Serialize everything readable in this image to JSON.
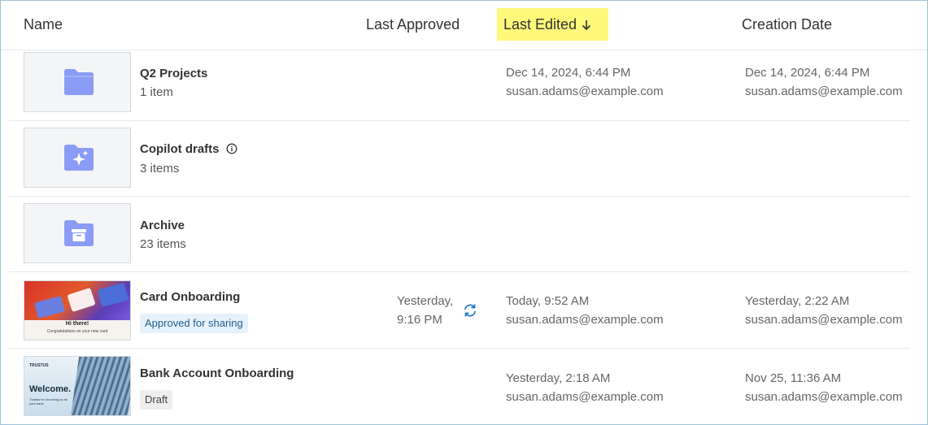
{
  "columns": {
    "name": "Name",
    "last_approved": "Last Approved",
    "last_edited": "Last Edited",
    "creation_date": "Creation Date"
  },
  "sort": {
    "column": "Last Edited",
    "direction": "descending",
    "highlight": "#fff87a"
  },
  "rows": [
    {
      "title": "Q2 Projects",
      "subtitle": "1 item",
      "icon": "folder-icon",
      "edited_date": "Dec 14, 2024, 6:44 PM",
      "edited_by": "susan.adams@example.com",
      "created_date": "Dec 14, 2024, 6:44 PM",
      "created_by": "susan.adams@example.com"
    },
    {
      "title": "Copilot drafts",
      "subtitle": "3 items",
      "icon": "sparkle-folder-icon"
    },
    {
      "title": "Archive",
      "subtitle": "23 items",
      "icon": "archive-folder-icon"
    },
    {
      "title": "Card Onboarding",
      "badge": "Approved for sharing",
      "thumb_heading": "Hi there!",
      "thumb_sub": "Congratulations on your new card",
      "approved_line1": "Yesterday,",
      "approved_line2": "9:16 PM",
      "edited_date": "Today, 9:52 AM",
      "edited_by": "susan.adams@example.com",
      "created_date": "Yesterday, 2:22 AM",
      "created_by": "susan.adams@example.com"
    },
    {
      "title": "Bank Account Onboarding",
      "badge": "Draft",
      "thumb_brand": "TRUSTUS",
      "thumb_heading": "Welcome.",
      "thumb_sub": "Thanks for choosing us as your bank",
      "edited_date": "Yesterday, 2:18 AM",
      "edited_by": "susan.adams@example.com",
      "created_date": "Nov 25, 11:36 AM",
      "created_by": "susan.adams@example.com"
    }
  ],
  "colors": {
    "folder": "#8a9cf5",
    "accent": "#1a73c8",
    "border": "#9fc3d6"
  }
}
